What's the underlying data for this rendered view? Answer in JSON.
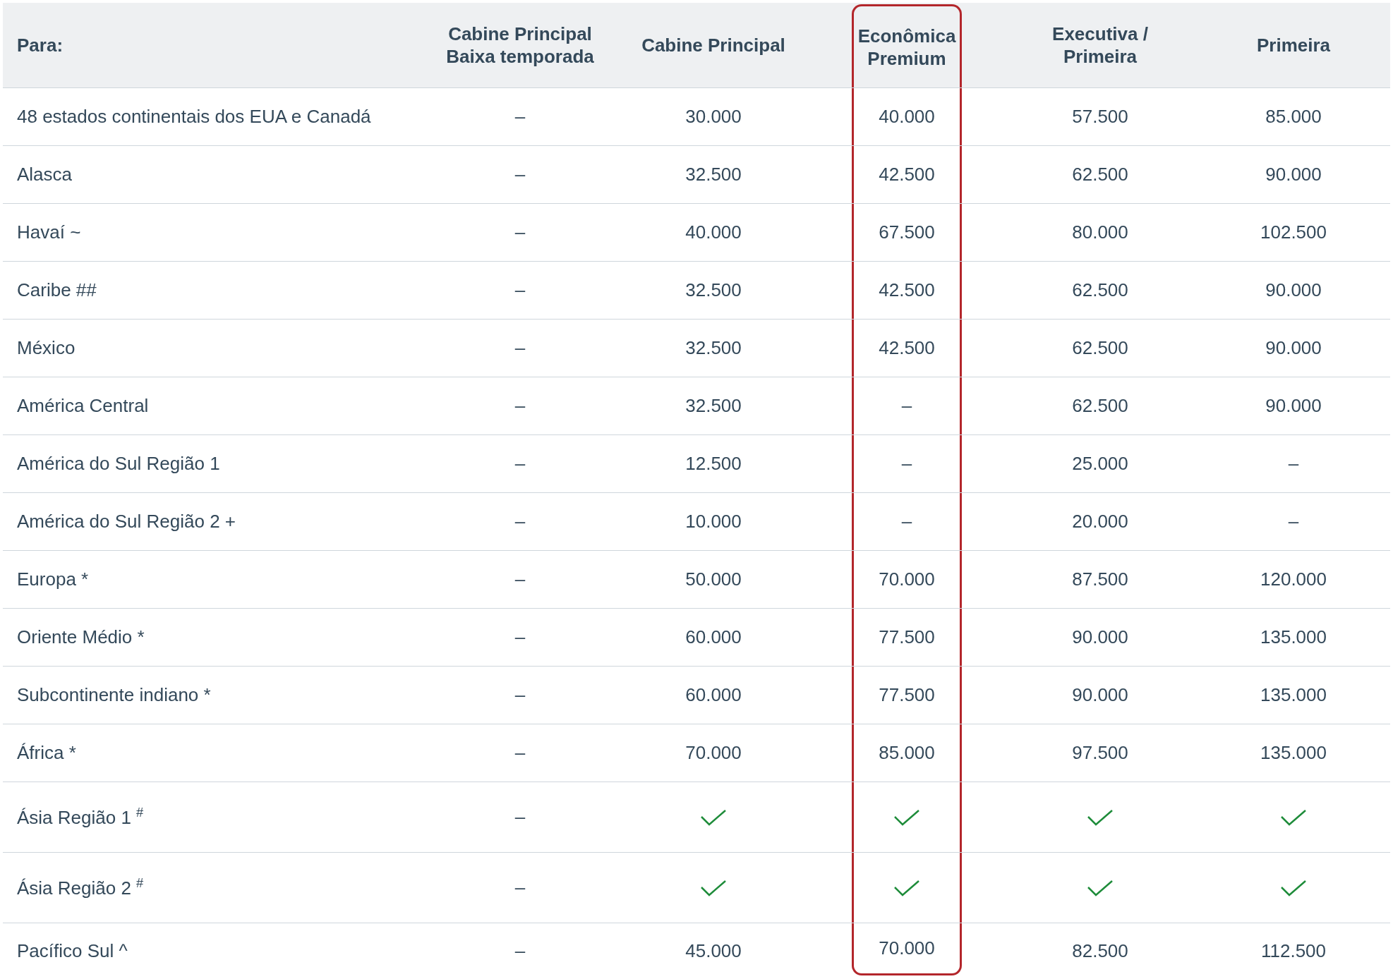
{
  "table": {
    "columns": [
      {
        "label": "Para:",
        "highlighted": false
      },
      {
        "label": "Cabine Principal Baixa temporada",
        "highlighted": false
      },
      {
        "label": "Cabine Principal",
        "highlighted": false
      },
      {
        "label": "Econômica Premium",
        "highlighted": true
      },
      {
        "label": "Executiva / Primeira",
        "highlighted": false
      },
      {
        "label": "Primeira",
        "highlighted": false
      }
    ],
    "rows": [
      {
        "cells": [
          {
            "kind": "destination",
            "text": "48 estados continentais dos EUA e Canadá"
          },
          {
            "kind": "text",
            "text": "–"
          },
          {
            "kind": "text",
            "text": "30.000"
          },
          {
            "kind": "text",
            "text": "40.000"
          },
          {
            "kind": "text",
            "text": "57.500"
          },
          {
            "kind": "text",
            "text": "85.000"
          }
        ]
      },
      {
        "cells": [
          {
            "kind": "destination",
            "text": "Alasca"
          },
          {
            "kind": "text",
            "text": "–"
          },
          {
            "kind": "text",
            "text": "32.500"
          },
          {
            "kind": "text",
            "text": "42.500"
          },
          {
            "kind": "text",
            "text": "62.500"
          },
          {
            "kind": "text",
            "text": "90.000"
          }
        ]
      },
      {
        "cells": [
          {
            "kind": "destination",
            "text": "Havaí ~"
          },
          {
            "kind": "text",
            "text": "–"
          },
          {
            "kind": "text",
            "text": "40.000"
          },
          {
            "kind": "text",
            "text": "67.500"
          },
          {
            "kind": "text",
            "text": "80.000"
          },
          {
            "kind": "text",
            "text": "102.500"
          }
        ]
      },
      {
        "cells": [
          {
            "kind": "destination",
            "text": "Caribe ##"
          },
          {
            "kind": "text",
            "text": "–"
          },
          {
            "kind": "text",
            "text": "32.500"
          },
          {
            "kind": "text",
            "text": "42.500"
          },
          {
            "kind": "text",
            "text": "62.500"
          },
          {
            "kind": "text",
            "text": "90.000"
          }
        ]
      },
      {
        "cells": [
          {
            "kind": "destination",
            "text": "México"
          },
          {
            "kind": "text",
            "text": "–"
          },
          {
            "kind": "text",
            "text": "32.500"
          },
          {
            "kind": "text",
            "text": "42.500"
          },
          {
            "kind": "text",
            "text": "62.500"
          },
          {
            "kind": "text",
            "text": "90.000"
          }
        ]
      },
      {
        "cells": [
          {
            "kind": "destination",
            "text": "América Central"
          },
          {
            "kind": "text",
            "text": "–"
          },
          {
            "kind": "text",
            "text": "32.500"
          },
          {
            "kind": "text",
            "text": "–"
          },
          {
            "kind": "text",
            "text": "62.500"
          },
          {
            "kind": "text",
            "text": "90.000"
          }
        ]
      },
      {
        "cells": [
          {
            "kind": "destination",
            "text": "América do Sul Região 1"
          },
          {
            "kind": "text",
            "text": "–"
          },
          {
            "kind": "text",
            "text": "12.500"
          },
          {
            "kind": "text",
            "text": "–"
          },
          {
            "kind": "text",
            "text": "25.000"
          },
          {
            "kind": "text",
            "text": "–"
          }
        ]
      },
      {
        "cells": [
          {
            "kind": "destination",
            "text": "América do Sul Região 2 +"
          },
          {
            "kind": "text",
            "text": "–"
          },
          {
            "kind": "text",
            "text": "10.000"
          },
          {
            "kind": "text",
            "text": "–"
          },
          {
            "kind": "text",
            "text": "20.000"
          },
          {
            "kind": "text",
            "text": "–"
          }
        ]
      },
      {
        "cells": [
          {
            "kind": "destination",
            "text": "Europa *"
          },
          {
            "kind": "text",
            "text": "–"
          },
          {
            "kind": "text",
            "text": "50.000"
          },
          {
            "kind": "text",
            "text": "70.000"
          },
          {
            "kind": "text",
            "text": "87.500"
          },
          {
            "kind": "text",
            "text": "120.000"
          }
        ]
      },
      {
        "cells": [
          {
            "kind": "destination",
            "text": "Oriente Médio *"
          },
          {
            "kind": "text",
            "text": "–"
          },
          {
            "kind": "text",
            "text": "60.000"
          },
          {
            "kind": "text",
            "text": "77.500"
          },
          {
            "kind": "text",
            "text": "90.000"
          },
          {
            "kind": "text",
            "text": "135.000"
          }
        ]
      },
      {
        "cells": [
          {
            "kind": "destination",
            "text": "Subcontinente indiano *"
          },
          {
            "kind": "text",
            "text": "–"
          },
          {
            "kind": "text",
            "text": "60.000"
          },
          {
            "kind": "text",
            "text": "77.500"
          },
          {
            "kind": "text",
            "text": "90.000"
          },
          {
            "kind": "text",
            "text": "135.000"
          }
        ]
      },
      {
        "cells": [
          {
            "kind": "destination",
            "text": "África *"
          },
          {
            "kind": "text",
            "text": "–"
          },
          {
            "kind": "text",
            "text": "70.000"
          },
          {
            "kind": "text",
            "text": "85.000"
          },
          {
            "kind": "text",
            "text": "97.500"
          },
          {
            "kind": "text",
            "text": "135.000"
          }
        ]
      },
      {
        "cells": [
          {
            "kind": "destination",
            "text": "Ásia Região 1 $^{#}$"
          },
          {
            "kind": "text",
            "text": "–"
          },
          {
            "kind": "check"
          },
          {
            "kind": "check"
          },
          {
            "kind": "check"
          },
          {
            "kind": "check"
          }
        ]
      },
      {
        "cells": [
          {
            "kind": "destination",
            "text": "Ásia Região 2 $^{#}$"
          },
          {
            "kind": "text",
            "text": "–"
          },
          {
            "kind": "check"
          },
          {
            "kind": "check"
          },
          {
            "kind": "check"
          },
          {
            "kind": "check"
          }
        ]
      },
      {
        "cells": [
          {
            "kind": "destination",
            "text": "Pacífico Sul ^"
          },
          {
            "kind": "text",
            "text": "–"
          },
          {
            "kind": "text",
            "text": "45.000"
          },
          {
            "kind": "text",
            "text": "70.000"
          },
          {
            "kind": "text",
            "text": "82.500"
          },
          {
            "kind": "text",
            "text": "112.500"
          }
        ]
      }
    ]
  }
}
